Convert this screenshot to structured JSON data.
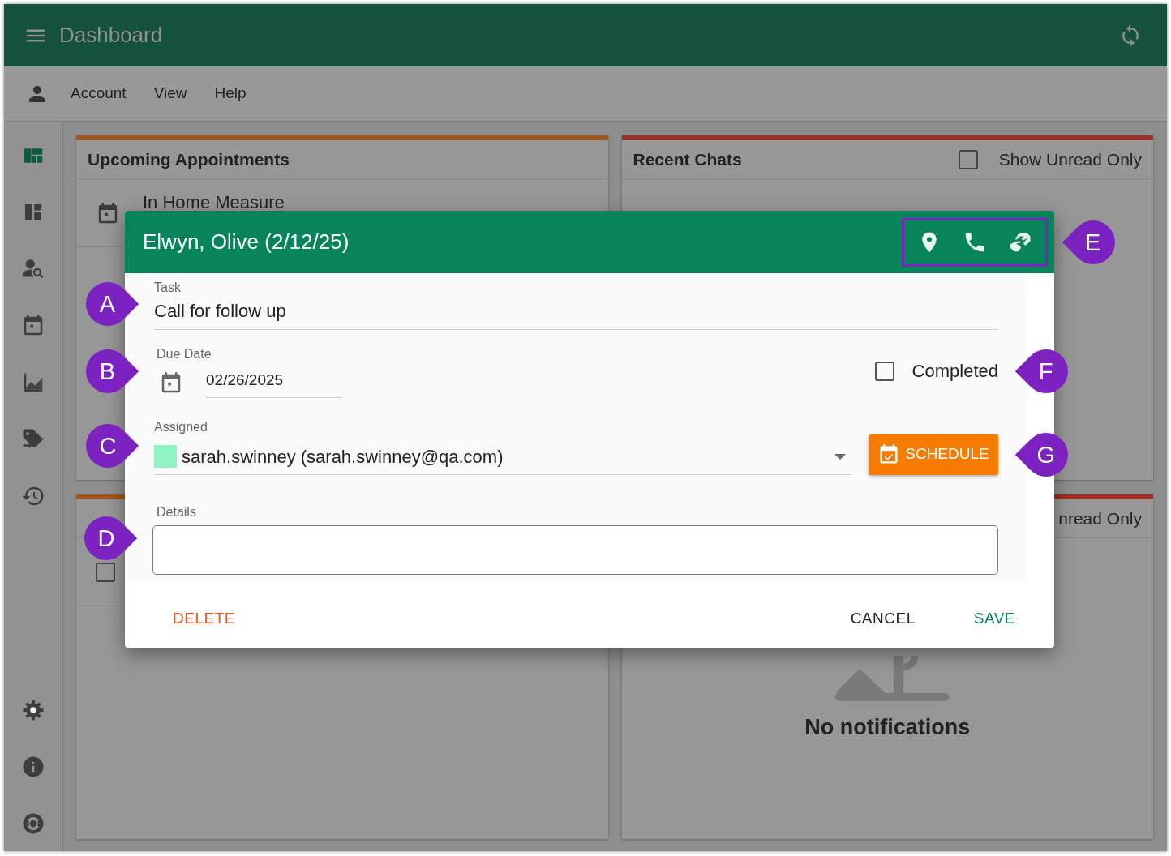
{
  "app_bar": {
    "title": "Dashboard"
  },
  "menu_bar": {
    "items": [
      "Account",
      "View",
      "Help"
    ]
  },
  "sidebar": {
    "items": [
      {
        "kind": "dashboard",
        "selected": true
      },
      {
        "kind": "board",
        "selected": false
      },
      {
        "kind": "person-search",
        "selected": false
      },
      {
        "kind": "calendar",
        "selected": false
      },
      {
        "kind": "chart",
        "selected": false
      },
      {
        "kind": "tag",
        "selected": false
      },
      {
        "kind": "history",
        "selected": false
      }
    ],
    "bottom_items": [
      {
        "kind": "settings"
      },
      {
        "kind": "info"
      },
      {
        "kind": "lifebuoy"
      }
    ]
  },
  "panels": [
    {
      "title": "Upcoming Appointments",
      "color": "#a0561a",
      "rows": [
        {
          "kind": "appointment",
          "text": "In Home Measure"
        }
      ]
    },
    {
      "title": "Recent Chats",
      "color": "#9c3027",
      "filter": {
        "label": "Show Unread Only",
        "checked": false
      }
    },
    {
      "color": "#a0561a",
      "rows": [
        {
          "kind": "checkbox",
          "checked": false
        }
      ]
    },
    {
      "color": "#9c3027",
      "filter": {
        "label": "nread Only"
      },
      "empty_text": "No notifications"
    }
  ],
  "dialog": {
    "title": "Elwyn, Olive (2/12/25)",
    "actions": {
      "highlighted": true,
      "callout": "E",
      "items": [
        {
          "kind": "location"
        },
        {
          "kind": "phone"
        },
        {
          "kind": "handshake"
        }
      ]
    },
    "task": {
      "label": "Task",
      "value": "Call for follow up",
      "callout": "A"
    },
    "due_date": {
      "label": "Due Date",
      "value": "02/26/2025",
      "callout": "B"
    },
    "completed": {
      "label": "Completed",
      "checked": false,
      "callout": "F"
    },
    "assigned": {
      "label": "Assigned",
      "value": "sarah.swinney (sarah.swinney@qa.com)",
      "color": "#8ff5c0",
      "callout": "C"
    },
    "schedule_button": {
      "label": "SCHEDULE",
      "callout": "G"
    },
    "details": {
      "label": "Details",
      "callout": "D"
    },
    "buttons": [
      {
        "kind": "delete",
        "label": "DELETE"
      },
      {
        "kind": "cancel",
        "label": "CANCEL"
      },
      {
        "kind": "save",
        "label": "SAVE"
      }
    ]
  }
}
